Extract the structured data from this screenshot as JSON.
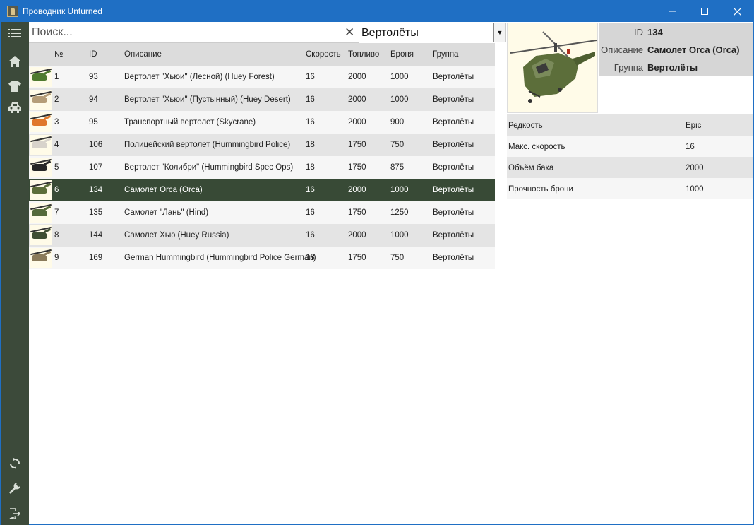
{
  "window": {
    "title": "Проводник Unturned",
    "minimize_icon": "minimize-icon",
    "maximize_icon": "maximize-icon",
    "close_icon": "close-icon"
  },
  "sidebar": {
    "items": [
      {
        "name": "menu",
        "icon": "list-icon"
      },
      {
        "name": "home",
        "icon": "home-icon"
      },
      {
        "name": "clothing",
        "icon": "shirt-icon"
      },
      {
        "name": "vehicles",
        "icon": "car-icon"
      },
      {
        "name": "sync",
        "icon": "sync-icon"
      },
      {
        "name": "settings",
        "icon": "wrench-icon"
      },
      {
        "name": "exit",
        "icon": "exit-icon"
      }
    ]
  },
  "search": {
    "placeholder": "Поиск...",
    "value": ""
  },
  "filter": {
    "selected": "Вертолёты"
  },
  "table": {
    "headers": [
      "№",
      "ID",
      "Описание",
      "Скорость",
      "Топливо",
      "Броня",
      "Группа"
    ],
    "rows": [
      {
        "n": "1",
        "id": "93",
        "desc": "Вертолет \"Хьюи\" (Лесной) (Huey Forest)",
        "speed": "16",
        "fuel": "2000",
        "armor": "1000",
        "group": "Вертолёты",
        "color": "#4f7a2e"
      },
      {
        "n": "2",
        "id": "94",
        "desc": "Вертолет \"Хьюи\" (Пустынный) (Huey Desert)",
        "speed": "16",
        "fuel": "2000",
        "armor": "1000",
        "group": "Вертолёты",
        "color": "#b59d78"
      },
      {
        "n": "3",
        "id": "95",
        "desc": "Транспортный вертолет (Skycrane)",
        "speed": "16",
        "fuel": "2000",
        "armor": "900",
        "group": "Вертолёты",
        "color": "#e0772a"
      },
      {
        "n": "4",
        "id": "106",
        "desc": "Полицейский вертолет (Hummingbird Police)",
        "speed": "18",
        "fuel": "1750",
        "armor": "750",
        "group": "Вертолёты",
        "color": "#d8d3cb"
      },
      {
        "n": "5",
        "id": "107",
        "desc": "Вертолет \"Колибри\" (Hummingbird Spec Ops)",
        "speed": "18",
        "fuel": "1750",
        "armor": "875",
        "group": "Вертолёты",
        "color": "#262626"
      },
      {
        "n": "6",
        "id": "134",
        "desc": "Самолет Orca (Orca)",
        "speed": "16",
        "fuel": "2000",
        "armor": "1000",
        "group": "Вертолёты",
        "color": "#5c6e3a",
        "selected": true
      },
      {
        "n": "7",
        "id": "135",
        "desc": "Самолет \"Лань\" (Hind)",
        "speed": "16",
        "fuel": "1750",
        "armor": "1250",
        "group": "Вертолёты",
        "color": "#556a3a"
      },
      {
        "n": "8",
        "id": "144",
        "desc": "Самолет Хью (Huey Russia)",
        "speed": "16",
        "fuel": "2000",
        "armor": "1000",
        "group": "Вертолёты",
        "color": "#3f4e33"
      },
      {
        "n": "9",
        "id": "169",
        "desc": "German Hummingbird (Hummingbird Police German)",
        "speed": "18",
        "fuel": "1750",
        "armor": "750",
        "group": "Вертолёты",
        "color": "#8a7a5a"
      }
    ]
  },
  "details": {
    "preview_icon": "orca-helicopter-image",
    "id_label": "ID",
    "id_value": "134",
    "desc_label": "Описание",
    "desc_value": "Самолет Orca (Orca)",
    "group_label": "Группа",
    "group_value": "Вертолёты",
    "props": [
      {
        "k": "Редкость",
        "v": "Epic"
      },
      {
        "k": "Макс. скорость",
        "v": "16"
      },
      {
        "k": "Объём бака",
        "v": "2000"
      },
      {
        "k": "Прочность брони",
        "v": "1000"
      }
    ]
  },
  "colors": {
    "titlebar": "#1f6fc4",
    "sidebar": "#3c4a3a",
    "selected_row": "#384a36"
  }
}
